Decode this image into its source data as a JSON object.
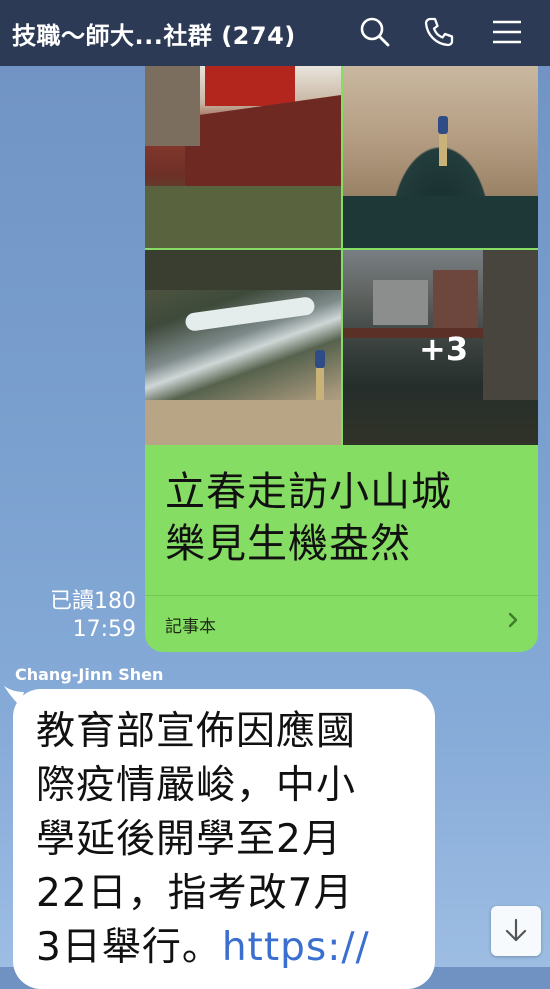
{
  "header": {
    "title": "技職～師大...社群 (274)",
    "icons": [
      "search-icon",
      "phone-icon",
      "menu-icon"
    ]
  },
  "album_message": {
    "caption_line1": "立春走訪小山城",
    "caption_line2": "樂見生機盎然",
    "photo_count_more": "+3",
    "footer_label": "記事本",
    "read_status": "已讀180",
    "time": "17:59"
  },
  "incoming_message": {
    "sender": "Chang-Jinn Shen",
    "line1": "教育部宣佈因應國",
    "line2": "際疫情嚴峻，中小",
    "line3": "學延後開學至2月",
    "line4": "22日，指考改7月",
    "line5_text": "3日舉行。",
    "line5_link": "https://"
  },
  "colors": {
    "header_bg": "#2c3a56",
    "outgoing_bubble": "#86dd64",
    "incoming_bubble": "#ffffff",
    "link": "#3a6fd0"
  }
}
